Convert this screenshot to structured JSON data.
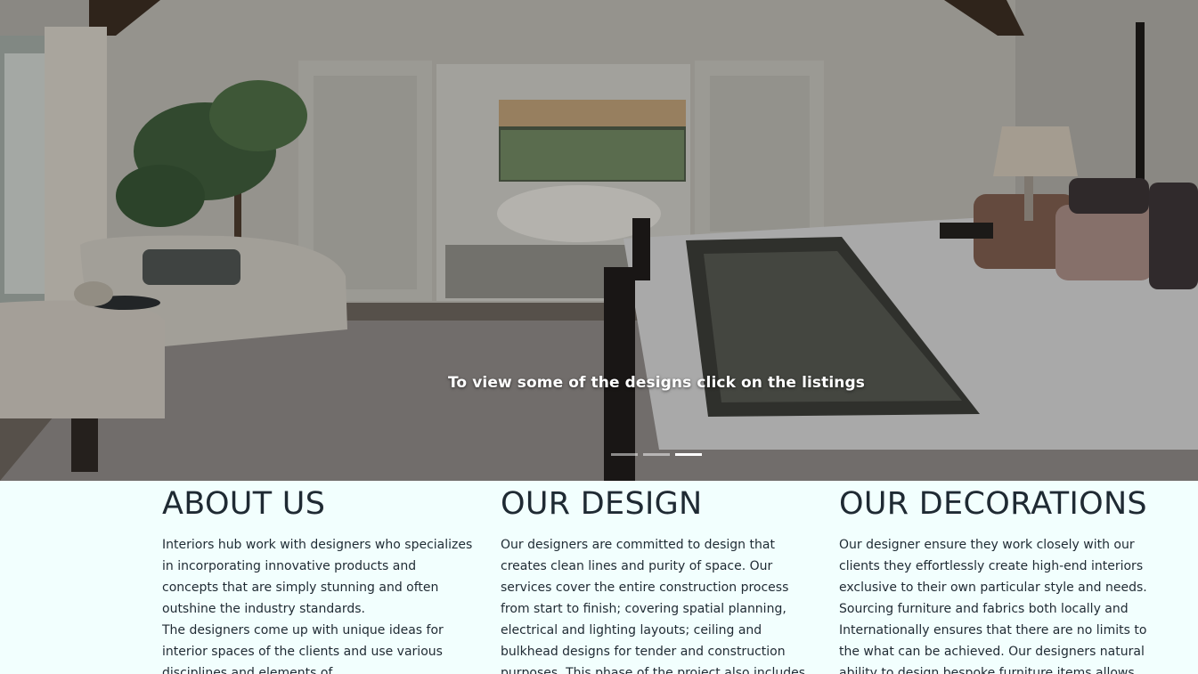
{
  "hero": {
    "caption": "To view some of the designs click on the listings",
    "slides": [
      {
        "active": false
      },
      {
        "active": false
      },
      {
        "active": true
      }
    ]
  },
  "sections": {
    "about": {
      "heading": "ABOUT US",
      "paragraphs": [
        "Interiors hub work with designers who specializes in incorporating innovative products and concepts that are simply stunning and often outshine the industry standards.",
        "The designers come up with unique ideas for interior spaces of the clients and use various disciplines and elements of"
      ]
    },
    "design": {
      "heading": "OUR DESIGN",
      "paragraphs": [
        "Our designers are committed to design that creates clean lines and purity of space. Our services cover the entire construction process from start to finish; covering spatial planning, electrical and lighting layouts; ceiling and bulkhead designs for tender and construction purposes. This phase of the project also includes the specification or all finishes"
      ]
    },
    "decorations": {
      "heading": "OUR DECORATIONS",
      "paragraphs": [
        "Our designer ensure they work closely with our clients they effortlessly create high-end interiors exclusive to their own particular style and needs. Sourcing furniture and fabrics both locally and Internationally ensures that there are no limits to the what can be achieved. Our designers natural ability to design bespoke furniture items allows us"
      ]
    }
  }
}
